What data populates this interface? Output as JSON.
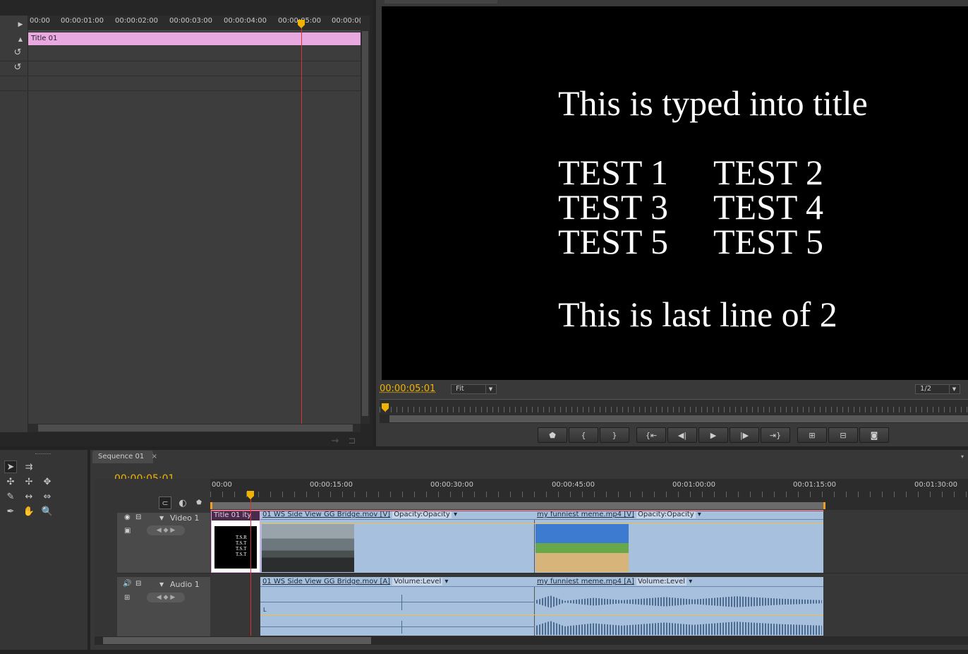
{
  "effect_controls": {
    "ruler_labels": [
      "00:00",
      "00:00:01:00",
      "00:00:02:00",
      "00:00:03:00",
      "00:00:04:00",
      "00:00:05:00",
      "00:00:0("
    ],
    "clip_label": "Title 01"
  },
  "program_monitor": {
    "lines": [
      "This is typed into title",
      "TEST 1",
      "TEST 2",
      "TEST 3",
      "TEST 4",
      "TEST 5",
      "TEST 5",
      "This is last line of 2"
    ],
    "timecode": "00:00:05:01",
    "zoom": "Fit",
    "resolution": "1/2"
  },
  "sequence": {
    "tab": "Sequence 01",
    "timecode": "00:00:05:01",
    "ruler_labels": [
      "00:00",
      "00:00:15:00",
      "00:00:30:00",
      "00:00:45:00",
      "00:01:00:00",
      "00:01:15:00",
      "00:01:30:00"
    ],
    "video_track": "Video 1",
    "audio_track": "Audio 1",
    "clips": {
      "title": "Title 01",
      "title_suffix": "ity",
      "bridge_v": "01 WS Side View GG Bridge.mov [V]",
      "bridge_v_prop": "Opacity:Opacity",
      "meme_v": "my funniest meme.mp4 [V]",
      "meme_v_prop": "Opacity:Opacity",
      "bridge_a": "01 WS Side View GG Bridge.mov [A]",
      "bridge_a_prop": "Volume:Level",
      "meme_a": "my funniest meme.mp4 [A]",
      "meme_a_prop": "Volume:Level",
      "channel_label": "L"
    }
  },
  "colors": {
    "accent": "#f0b400",
    "clip_pink": "#e8a8e0",
    "clip_blue": "#a7c0de",
    "playhead": "#e03030"
  }
}
